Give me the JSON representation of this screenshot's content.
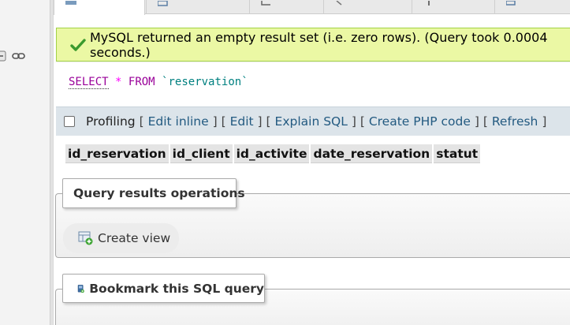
{
  "message": {
    "text": "MySQL returned an empty result set (i.e. zero rows). (Query took 0.0004 seconds.)",
    "icon": "success-check-icon",
    "background": "#ebf8a4",
    "border": "#a2d246"
  },
  "sql": {
    "kw_select": "SELECT",
    "op_star": "*",
    "kw_from": "FROM",
    "table": "`reservation`"
  },
  "toolbar": {
    "profiling_label": "Profiling",
    "edit_inline": "Edit inline",
    "edit": "Edit",
    "explain_sql": "Explain SQL",
    "create_php": "Create PHP code",
    "refresh": "Refresh",
    "bracket_open": "[",
    "bracket_close": "]",
    "link_color": "#235a81"
  },
  "results": {
    "columns": [
      "id_reservation",
      "id_client",
      "id_activite",
      "date_reservation",
      "statut"
    ]
  },
  "operations": {
    "title": "Query results operations",
    "create_view": "Create view"
  },
  "bookmark": {
    "title": "Bookmark this SQL query"
  },
  "icons": {
    "nav": [
      "collapse-icon",
      "link-icon"
    ],
    "tabs": [
      "browse-icon",
      "structure-icon",
      "sql-icon",
      "search-icon",
      "insert-icon",
      "export-icon"
    ]
  }
}
